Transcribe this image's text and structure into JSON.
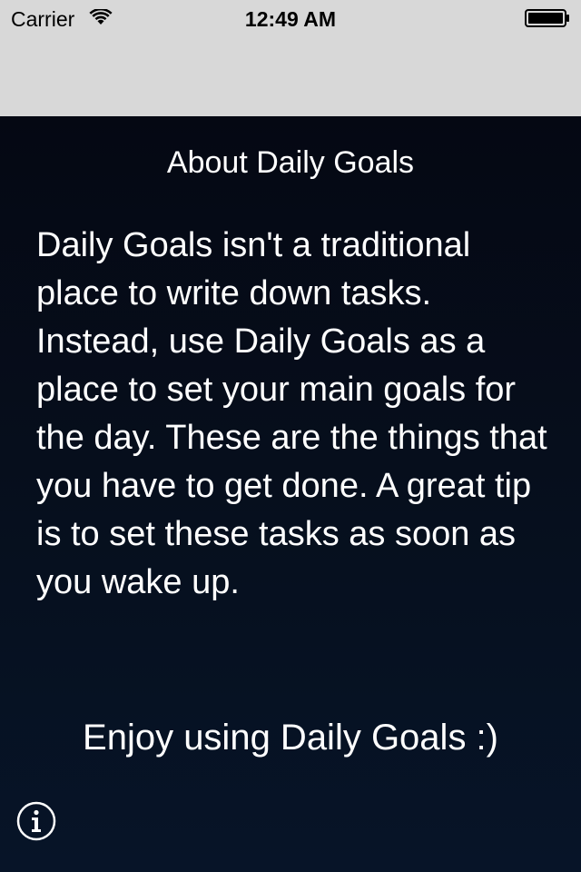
{
  "status_bar": {
    "carrier": "Carrier",
    "time": "12:49 AM",
    "wifi_icon": "wifi-icon",
    "battery_icon": "battery-icon"
  },
  "about": {
    "title": "About Daily Goals",
    "body": "Daily Goals isn't a traditional place to write down tasks. Instead, use Daily Goals as a place to set your main goals for the day. These are the things that you have to get done. A great tip is to set these tasks as soon as you wake up.",
    "enjoy": "Enjoy using Daily Goals :)"
  },
  "info_button": {
    "icon": "info-icon"
  },
  "colors": {
    "status_bar_bg": "#d8d8d8",
    "content_bg_top": "#050813",
    "content_bg_bottom": "#071428",
    "text": "#ffffff"
  }
}
